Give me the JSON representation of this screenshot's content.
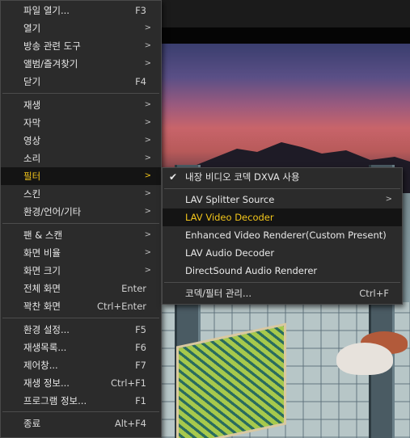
{
  "main_menu": {
    "items": [
      {
        "label": "파일 열기...",
        "shortcut": "F3"
      },
      {
        "label": "열기",
        "arrow": ">"
      },
      {
        "label": "방송 관련 도구",
        "arrow": ">"
      },
      {
        "label": "앨범/즐겨찾기",
        "arrow": ">"
      },
      {
        "label": "닫기",
        "shortcut": "F4"
      },
      {
        "label": "재생",
        "arrow": ">"
      },
      {
        "label": "자막",
        "arrow": ">"
      },
      {
        "label": "영상",
        "arrow": ">"
      },
      {
        "label": "소리",
        "arrow": ">"
      },
      {
        "label": "필터",
        "arrow": ">"
      },
      {
        "label": "스킨",
        "arrow": ">"
      },
      {
        "label": "환경/언어/기타",
        "arrow": ">"
      },
      {
        "label": "팬 & 스캔",
        "arrow": ">"
      },
      {
        "label": "화면 비율",
        "arrow": ">"
      },
      {
        "label": "화면 크기",
        "arrow": ">"
      },
      {
        "label": "전체 화면",
        "shortcut": "Enter"
      },
      {
        "label": "꽉찬 화면",
        "shortcut": "Ctrl+Enter"
      },
      {
        "label": "환경 설정...",
        "shortcut": "F5"
      },
      {
        "label": "재생목록...",
        "shortcut": "F6"
      },
      {
        "label": "제어창...",
        "shortcut": "F7"
      },
      {
        "label": "재생 정보...",
        "shortcut": "Ctrl+F1"
      },
      {
        "label": "프로그램 정보...",
        "shortcut": "F1"
      },
      {
        "label": "종료",
        "shortcut": "Alt+F4"
      }
    ]
  },
  "filter_submenu": {
    "items": [
      {
        "label": "내장 비디오 코덱 DXVA 사용",
        "checked": true
      },
      {
        "label": "LAV Splitter Source",
        "arrow": ">"
      },
      {
        "label": "LAV Video Decoder"
      },
      {
        "label": "Enhanced Video Renderer(Custom Present)"
      },
      {
        "label": "LAV Audio Decoder"
      },
      {
        "label": "DirectSound Audio Renderer"
      },
      {
        "label": "코덱/필터 관리...",
        "shortcut": "Ctrl+F"
      }
    ]
  },
  "colors": {
    "menu_bg": "#2b2b2b",
    "active_text": "#f2c51b",
    "hover_bg": "#141414",
    "text": "#e8e8e8"
  }
}
